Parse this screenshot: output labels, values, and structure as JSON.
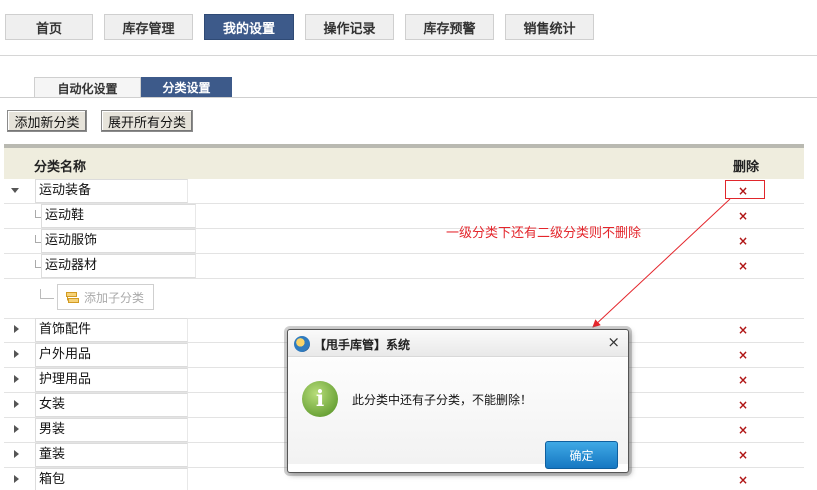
{
  "nav": {
    "tabs": [
      {
        "label": "首页"
      },
      {
        "label": "库存管理"
      },
      {
        "label": "我的设置"
      },
      {
        "label": "操作记录"
      },
      {
        "label": "库存预警"
      },
      {
        "label": "销售统计"
      }
    ],
    "active_index": 2
  },
  "subtabs": {
    "items": [
      {
        "label": "自动化设置"
      },
      {
        "label": "分类设置"
      }
    ],
    "active_index": 1
  },
  "actions": {
    "add_category": "添加新分类",
    "expand_all": "展开所有分类"
  },
  "table": {
    "headers": {
      "name": "分类名称",
      "delete": "删除"
    },
    "delete_symbol": "×",
    "rows": [
      {
        "name": "运动装备",
        "level": 1,
        "expanded": true
      },
      {
        "name": "运动鞋",
        "level": 2
      },
      {
        "name": "运动服饰",
        "level": 2
      },
      {
        "name": "运动器材",
        "level": 2
      },
      {
        "name": "首饰配件",
        "level": 1,
        "expanded": false
      },
      {
        "name": "户外用品",
        "level": 1,
        "expanded": false
      },
      {
        "name": "护理用品",
        "level": 1,
        "expanded": false
      },
      {
        "name": "女装",
        "level": 1,
        "expanded": false
      },
      {
        "name": "男装",
        "level": 1,
        "expanded": false
      },
      {
        "name": "童装",
        "level": 1,
        "expanded": false
      },
      {
        "name": "箱包",
        "level": 1,
        "expanded": false
      }
    ],
    "add_subcategory": "添加子分类"
  },
  "annotation": "一级分类下还有二级分类则不删除",
  "dialog": {
    "title": "【甩手库管】系统",
    "close": "×",
    "icon": "info-icon",
    "message": "此分类中还有子分类，不能删除！",
    "ok": "确定"
  },
  "colors": {
    "nav_active": "#3d5a8a",
    "delete_icon": "#b01515",
    "annotation": "#e4262c",
    "ok_button": "#1f86cf"
  }
}
